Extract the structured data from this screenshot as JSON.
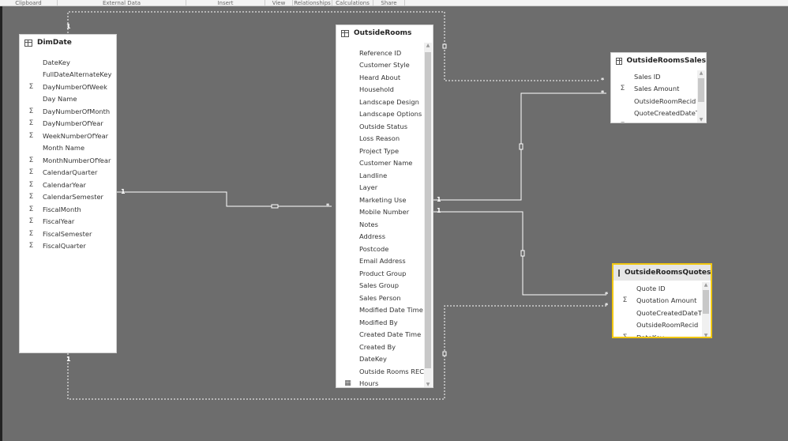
{
  "ribbon": [
    "Clipboard",
    "External Data",
    "Insert",
    "View",
    "Relationships",
    "Calculations",
    "Share"
  ],
  "tables": {
    "dimdate": {
      "name": "DimDate",
      "fields": [
        {
          "n": "DateKey",
          "s": false
        },
        {
          "n": "FullDateAlternateKey",
          "s": false
        },
        {
          "n": "DayNumberOfWeek",
          "s": true
        },
        {
          "n": "Day Name",
          "s": false
        },
        {
          "n": "DayNumberOfMonth",
          "s": true
        },
        {
          "n": "DayNumberOfYear",
          "s": true
        },
        {
          "n": "WeekNumberOfYear",
          "s": true
        },
        {
          "n": "Month Name",
          "s": false
        },
        {
          "n": "MonthNumberOfYear",
          "s": true
        },
        {
          "n": "CalendarQuarter",
          "s": true
        },
        {
          "n": "CalendarYear",
          "s": true
        },
        {
          "n": "CalendarSemester",
          "s": true
        },
        {
          "n": "FiscalMonth",
          "s": true
        },
        {
          "n": "FiscalYear",
          "s": true
        },
        {
          "n": "FiscalSemester",
          "s": true
        },
        {
          "n": "FiscalQuarter",
          "s": true
        }
      ]
    },
    "outsiderooms": {
      "name": "OutsideRooms",
      "fields": [
        {
          "n": "Reference ID"
        },
        {
          "n": "Customer Style"
        },
        {
          "n": "Heard About"
        },
        {
          "n": "Household"
        },
        {
          "n": "Landscape Design"
        },
        {
          "n": "Landscape Options"
        },
        {
          "n": "Outside Status"
        },
        {
          "n": "Loss Reason"
        },
        {
          "n": "Project Type"
        },
        {
          "n": "Customer Name"
        },
        {
          "n": "Landline"
        },
        {
          "n": "Layer"
        },
        {
          "n": "Marketing Use"
        },
        {
          "n": "Mobile Number"
        },
        {
          "n": "Notes"
        },
        {
          "n": "Address"
        },
        {
          "n": "Postcode"
        },
        {
          "n": "Email Address"
        },
        {
          "n": "Product Group"
        },
        {
          "n": "Sales Group"
        },
        {
          "n": "Sales Person"
        },
        {
          "n": "Modified Date Time"
        },
        {
          "n": "Modified By"
        },
        {
          "n": "Created Date Time"
        },
        {
          "n": "Created By"
        },
        {
          "n": "DateKey"
        },
        {
          "n": "Outside Rooms RECI"
        },
        {
          "n": "Hours",
          "c": true
        }
      ]
    },
    "sales": {
      "name": "OutsideRoomsSales",
      "fields": [
        {
          "n": "Sales ID",
          "s": false
        },
        {
          "n": "Sales Amount",
          "s": true
        },
        {
          "n": "OutsideRoomRecid",
          "s": false
        },
        {
          "n": "QuoteCreatedDateTi",
          "s": false
        },
        {
          "n": "DateKey",
          "s": true
        }
      ]
    },
    "quotes": {
      "name": "OutsideRoomsQuotes",
      "fields": [
        {
          "n": "Quote ID",
          "s": false
        },
        {
          "n": "Quotation Amount",
          "s": true
        },
        {
          "n": "QuoteCreatedDateTi",
          "s": false
        },
        {
          "n": "OutsideRoomRecid",
          "s": false
        },
        {
          "n": "DateKey",
          "s": true
        }
      ]
    }
  },
  "cardinality": {
    "one": "1",
    "many": "*"
  },
  "colors": {
    "selected_border": "#f2c811",
    "canvas": "#6d6d6d"
  }
}
